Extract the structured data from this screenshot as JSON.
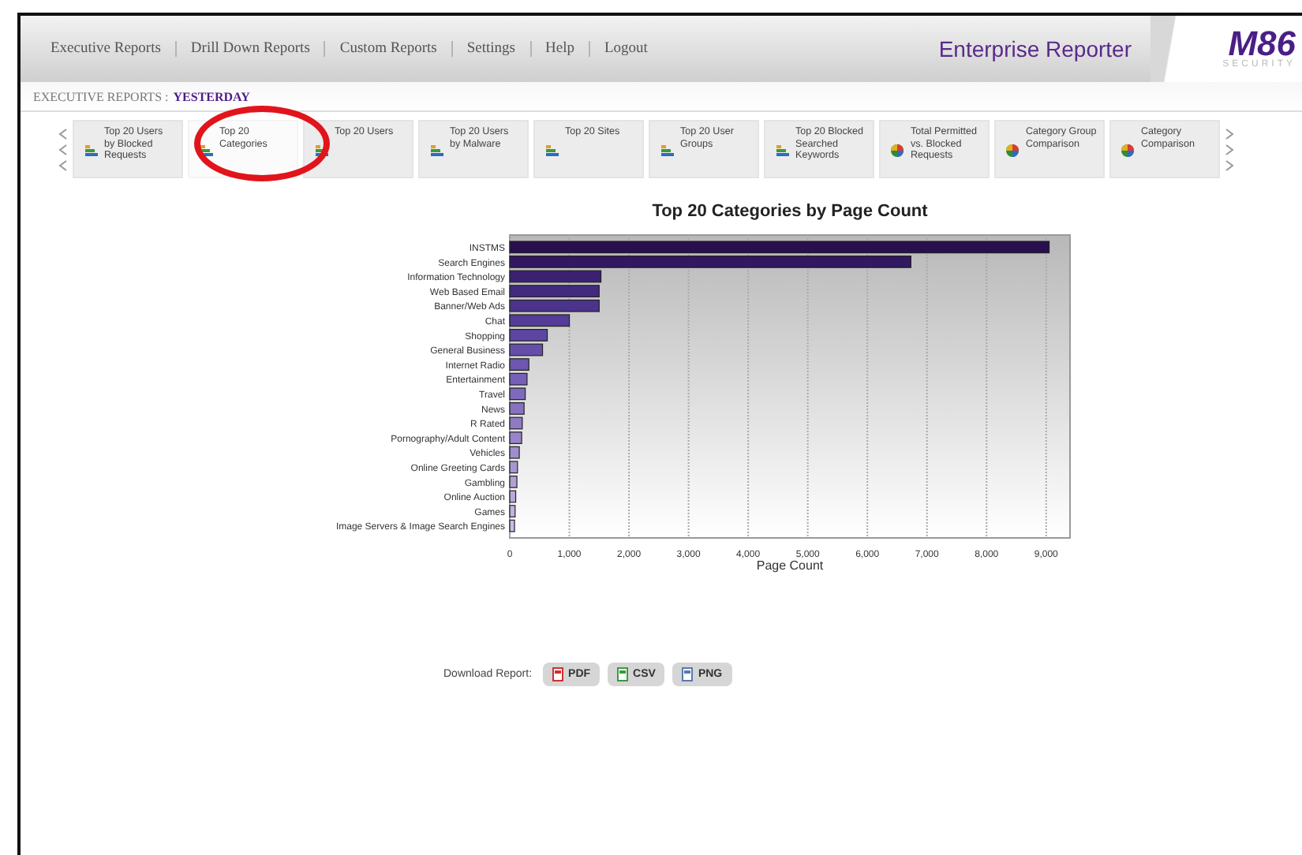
{
  "nav": {
    "items": [
      "Executive Reports",
      "Drill Down Reports",
      "Custom Reports",
      "Settings",
      "Help",
      "Logout"
    ],
    "product": "Enterprise Reporter",
    "logo": {
      "mark": "M86",
      "sub": "SECURITY"
    }
  },
  "breadcrumb": {
    "section": "EXECUTIVE REPORTS :",
    "current": "YESTERDAY"
  },
  "report_tabs": [
    {
      "label": "Top 20 Users by Blocked Requests",
      "kind": "bar",
      "selected": false
    },
    {
      "label": "Top 20 Categories",
      "kind": "bar",
      "selected": true
    },
    {
      "label": "Top 20 Users",
      "kind": "bar",
      "selected": false
    },
    {
      "label": "Top 20 Users by Malware",
      "kind": "bar",
      "selected": false
    },
    {
      "label": "Top 20 Sites",
      "kind": "bar",
      "selected": false
    },
    {
      "label": "Top 20 User Groups",
      "kind": "bar",
      "selected": false
    },
    {
      "label": "Top 20 Blocked Searched Keywords",
      "kind": "bar",
      "selected": false
    },
    {
      "label": "Total Permitted vs. Blocked Requests",
      "kind": "pie",
      "selected": false
    },
    {
      "label": "Category Group Comparison",
      "kind": "pie",
      "selected": false
    },
    {
      "label": "Category Comparison",
      "kind": "pie",
      "selected": false
    }
  ],
  "chart": {
    "chart_data": {
      "type": "bar",
      "orientation": "horizontal",
      "title": "Top 20 Categories by Page Count",
      "xlabel": "Page Count",
      "categories": [
        "INSTMS",
        "Search Engines",
        "Information Technology",
        "Web Based Email",
        "Banner/Web Ads",
        "Chat",
        "Shopping",
        "General Business",
        "Internet Radio",
        "Entertainment",
        "Travel",
        "News",
        "R Rated",
        "Pornography/Adult Content",
        "Vehicles",
        "Online Greeting Cards",
        "Gambling",
        "Online Auction",
        "Games",
        "Image Servers & Image Search Engines"
      ],
      "grid": true,
      "series": [
        {
          "values": [
            9050,
            6730,
            1530,
            1500,
            1500,
            1000,
            630,
            550,
            320,
            290,
            260,
            240,
            210,
            200,
            160,
            130,
            120,
            100,
            90,
            80
          ]
        }
      ],
      "xlim": [
        0,
        9400
      ],
      "xticks": [
        {
          "value": 0,
          "label": "0"
        },
        {
          "value": 1000,
          "label": "1,000"
        },
        {
          "value": 2000,
          "label": "2,000"
        },
        {
          "value": 3000,
          "label": "3,000"
        },
        {
          "value": 4000,
          "label": "4,000"
        },
        {
          "value": 5000,
          "label": "5,000"
        },
        {
          "value": 6000,
          "label": "6,000"
        },
        {
          "value": 7000,
          "label": "7,000"
        },
        {
          "value": 8000,
          "label": "8,000"
        },
        {
          "value": 9000,
          "label": "9,000"
        }
      ]
    }
  },
  "download": {
    "label": "Download Report:",
    "buttons": [
      {
        "label": "PDF",
        "kind": "pdf"
      },
      {
        "label": "CSV",
        "kind": "csv"
      },
      {
        "label": "PNG",
        "kind": "png"
      }
    ]
  }
}
